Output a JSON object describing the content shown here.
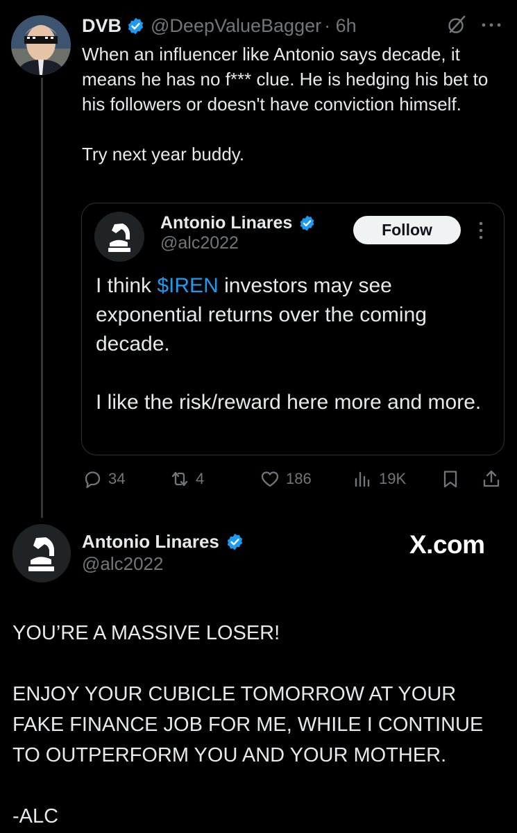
{
  "tweet": {
    "author_name": "DVB",
    "author_handle": "@DeepValueBagger",
    "time": "· 6h",
    "text": "When an influencer like Antonio says decade, it means he has no f*** clue.  He is hedging his bet to his followers or doesn't have conviction himself.\n\nTry next year buddy.",
    "icons": {
      "verified": "verified-badge-icon",
      "grok": "grok-icon",
      "more": "more-icon"
    }
  },
  "quote": {
    "author_name": "Antonio Linares",
    "author_handle": "@alc2022",
    "follow_label": "Follow",
    "text_before_cashtag": "I think ",
    "cashtag": "$IREN",
    "text_after_cashtag": " investors may see exponential returns over the coming decade.",
    "text_para2": "I like the risk/reward here more and more."
  },
  "actions": {
    "replies": "34",
    "reposts": "4",
    "likes": "186",
    "views": "19K"
  },
  "reply": {
    "author_name": "Antonio Linares",
    "author_handle": "@alc2022",
    "source": "X.com",
    "para1": "YOU’RE A MASSIVE LOSER!",
    "para2": "ENJOY YOUR CUBICLE TOMORROW AT YOUR FAKE FINANCE JOB FOR ME, WHILE I CONTINUE TO OUTPERFORM YOU AND YOUR MOTHER.",
    "para3": "-ALC"
  },
  "colors": {
    "background": "#000000",
    "text": "#e7e9ea",
    "muted": "#71767b",
    "accent": "#1d9bf0",
    "border": "#2f3336"
  }
}
